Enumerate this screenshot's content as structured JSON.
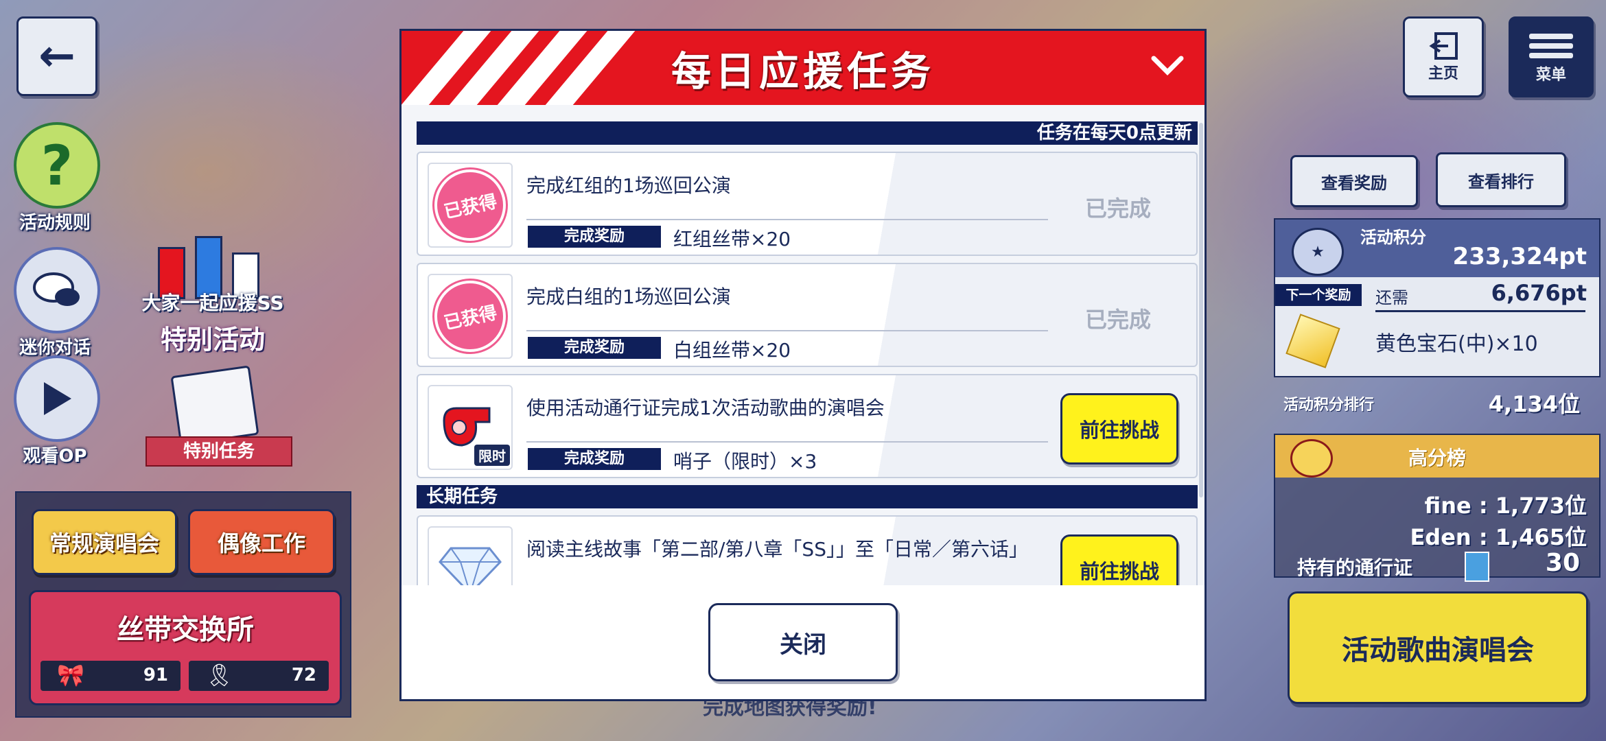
{
  "top_left": {
    "back_label": "←"
  },
  "left_side": {
    "rules_label": "活动规则",
    "chat_label": "迷你对话",
    "op_label": "观看OP",
    "event_logo_top": "大家一起应援SS",
    "event_logo_bottom": "特别活动",
    "special_mission_label": "特别任务",
    "regular_concert": "常规演唱会",
    "idol_work": "偶像工作",
    "ribbon_exchange": "丝带交换所",
    "red_ribbon_count": "91",
    "white_ribbon_count": "72"
  },
  "top_right": {
    "home_label": "主页",
    "menu_label": "菜单"
  },
  "right_panel": {
    "view_rewards": "查看奖励",
    "view_ranking": "查看排行",
    "points_label": "活动积分",
    "points_value": "233,324pt",
    "next_reward_label": "下一个奖励",
    "remaining_label": "还需",
    "remaining_value": "6,676pt",
    "next_reward_item": "黄色宝石(中)×10",
    "rank_label": "活动积分排行",
    "rank_value": "4,134位",
    "high_score_label": "高分榜",
    "fine_rank": "fine : 1,773位",
    "eden_rank": "Eden : 1,465位",
    "pass_label": "持有的通行证",
    "pass_count": "30",
    "event_song_button": "活动歌曲演唱会"
  },
  "modal": {
    "title": "每日应援任务",
    "refresh_note": "任务在每天0点更新",
    "long_term_header": "长期任务",
    "reward_tag": "完成奖励",
    "close_label": "关闭",
    "daily_missions": [
      {
        "title": "完成红组的1场巡回公演",
        "reward": "红组丝带×20",
        "status": "已完成",
        "icon": "obtained-stamp-icon",
        "stamp": "已获得"
      },
      {
        "title": "完成白组的1场巡回公演",
        "reward": "白组丝带×20",
        "status": "已完成",
        "icon": "obtained-stamp-icon",
        "stamp": "已获得"
      },
      {
        "title": "使用活动通行证完成1次活动歌曲的演唱会",
        "reward": "哨子（限时）×3",
        "action": "前往挑战",
        "icon": "whistle-icon",
        "badge": "限时"
      }
    ],
    "long_term_missions": [
      {
        "title": "阅读主线故事「第二部/第八章「SS」」至「日常／第六话」",
        "action": "前往挑战",
        "icon": "diamond-icon"
      }
    ]
  },
  "background_text": "完成地图获得奖励!",
  "colors": {
    "modal_header": "#e4151f",
    "navy": "#0f1f5a",
    "challenge_button": "#fff21c",
    "event_song_button": "#f2dd3c"
  }
}
